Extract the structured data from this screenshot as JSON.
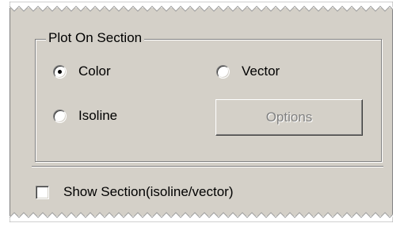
{
  "group": {
    "title": "Plot On Section",
    "radios": {
      "color": {
        "label": "Color",
        "checked": true
      },
      "vector": {
        "label": "Vector",
        "checked": false
      },
      "isoline": {
        "label": "Isoline",
        "checked": false
      }
    },
    "options_button": {
      "label": "Options",
      "enabled": false
    }
  },
  "show_section": {
    "label": "Show Section(isoline/vector)",
    "checked": false
  },
  "colors": {
    "panel_bg": "#d4d0c8",
    "shadow": "#808080",
    "highlight": "#ffffff",
    "disabled_text": "#808080"
  }
}
